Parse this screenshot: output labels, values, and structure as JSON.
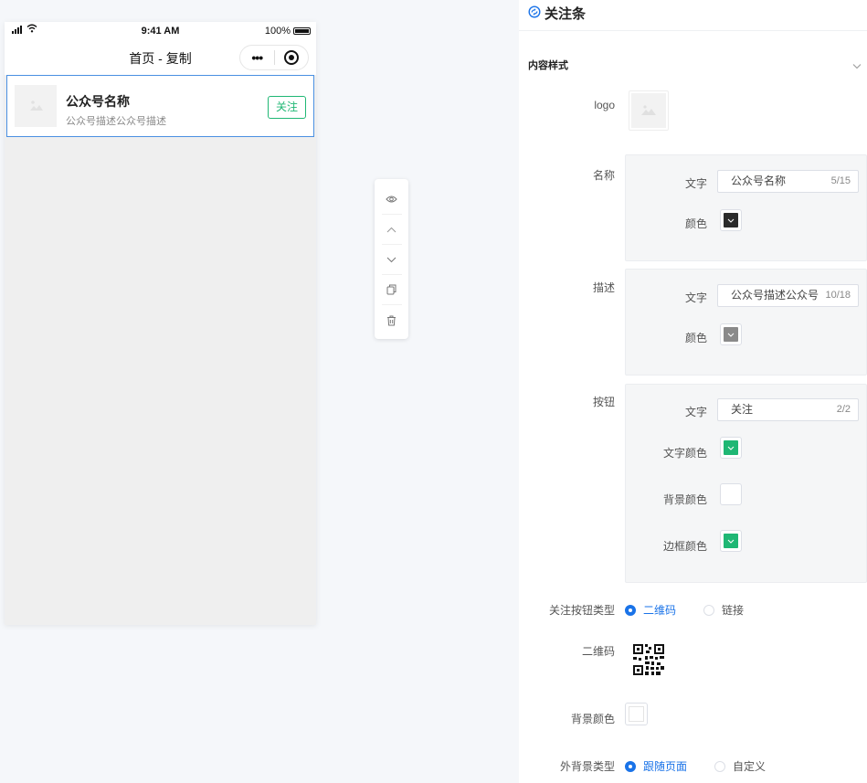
{
  "phone": {
    "status": {
      "time": "9:41 AM",
      "battery": "100%"
    },
    "nav_title": "首页 - 复制",
    "capsule": {
      "more": "•••"
    },
    "card": {
      "name": "公众号名称",
      "description": "公众号描述公众号描述",
      "follow_button": "关注"
    }
  },
  "toolbar": {
    "icons": [
      "eye-icon",
      "arrow-up-icon",
      "arrow-down-icon",
      "copy-icon",
      "delete-icon"
    ]
  },
  "panel": {
    "title": "关注条",
    "section": "内容样式",
    "logo_label": "logo",
    "name": {
      "label": "名称",
      "text_label": "文字",
      "text_value": "公众号名称",
      "text_count": "5/15",
      "color_label": "颜色",
      "color": "#2b2b2b"
    },
    "description": {
      "label": "描述",
      "text_label": "文字",
      "text_value": "公众号描述公众号",
      "text_count": "10/18",
      "color_label": "颜色",
      "color": "#8a8a8a"
    },
    "button": {
      "label": "按钮",
      "text_label": "文字",
      "text_value": "关注",
      "text_count": "2/2",
      "text_color_label": "文字颜色",
      "text_color": "#1fb774",
      "bg_color_label": "背景颜色",
      "bg_color": "#ffffff",
      "border_color_label": "边框颜色",
      "border_color": "#1fb774"
    },
    "follow_type": {
      "label": "关注按钮类型",
      "options": [
        "二维码",
        "链接"
      ],
      "selected": "二维码"
    },
    "qrcode_label": "二维码",
    "bg_color_label": "背景颜色",
    "outer_bg": {
      "label": "外背景类型",
      "options": [
        "跟随页面",
        "自定义"
      ],
      "selected": "跟随页面"
    }
  },
  "colors": {
    "accent": "#1a73e8",
    "follow_green": "#1fb774",
    "selection_border": "#4a90e2"
  }
}
